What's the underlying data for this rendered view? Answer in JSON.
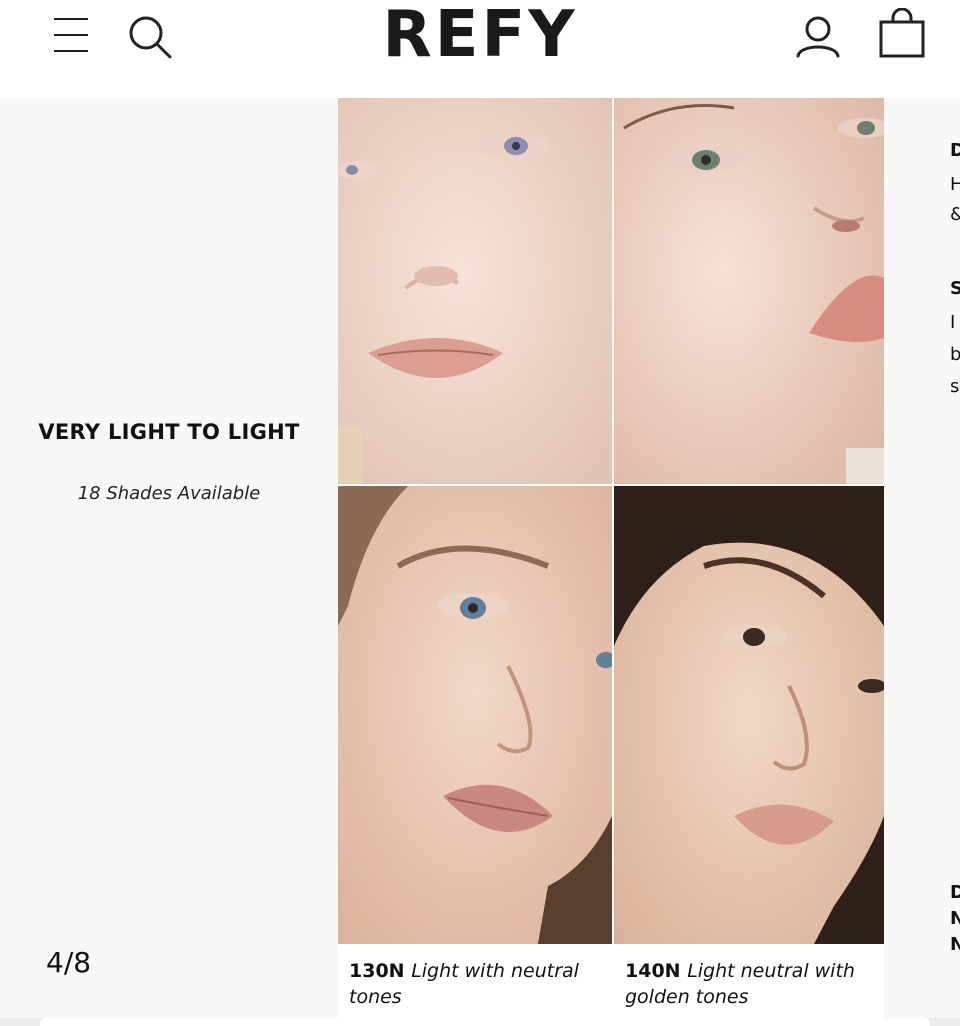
{
  "header": {
    "logo": "REFY",
    "menu_icon": "hamburger-menu-icon",
    "search_icon": "search-icon",
    "account_icon": "user-icon",
    "bag_icon": "shopping-bag-icon"
  },
  "left_panel": {
    "title": "VERY LIGHT TO LIGHT",
    "subtitle": "18 Shades Available",
    "slide_counter": "4/8"
  },
  "shades": [
    {
      "code": "130N",
      "description": "Light with neutral tones"
    },
    {
      "code": "140N",
      "description": "Light neutral with golden tones"
    }
  ],
  "right_panel": {
    "lines": [
      "D",
      "H",
      "&",
      "S",
      "I",
      "b",
      "s",
      "D",
      "N",
      "N"
    ]
  },
  "colors": {
    "panel_bg": "#f8f8f8",
    "text": "#111111"
  }
}
